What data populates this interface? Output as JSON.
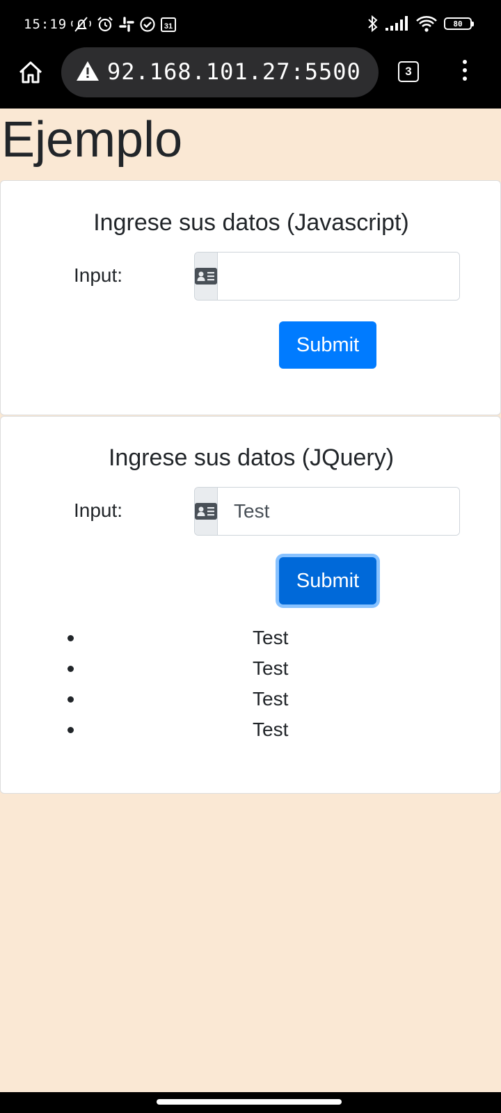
{
  "status_bar": {
    "time": "15:19",
    "calendar_day": "31",
    "battery": "80",
    "left_icons": [
      "muted-bell-icon",
      "alarm-icon",
      "slack-icon",
      "check-circle-icon",
      "calendar-icon"
    ],
    "right_icons": [
      "bluetooth-icon",
      "signal-icon",
      "wifi-icon",
      "battery-icon"
    ]
  },
  "browser": {
    "url": "92.168.101.27:5500",
    "tab_count": "3",
    "icons": [
      "home-icon",
      "warning-icon",
      "tabs-icon",
      "more-vert-icon"
    ]
  },
  "page": {
    "title": "Ejemplo"
  },
  "forms": {
    "javascript": {
      "title": "Ingrese sus datos (Javascript)",
      "input_label": "Input:",
      "input_value": "",
      "addon_icon": "id-card-icon",
      "submit_label": "Submit"
    },
    "jquery": {
      "title": "Ingrese sus datos (JQuery)",
      "input_label": "Input:",
      "input_value": "Test",
      "addon_icon": "id-card-icon",
      "submit_label": "Submit",
      "submit_focused": true,
      "results": [
        "Test",
        "Test",
        "Test",
        "Test"
      ]
    }
  },
  "colors": {
    "page_background": "#fae8d4",
    "primary": "#007bff",
    "text": "#212529"
  }
}
